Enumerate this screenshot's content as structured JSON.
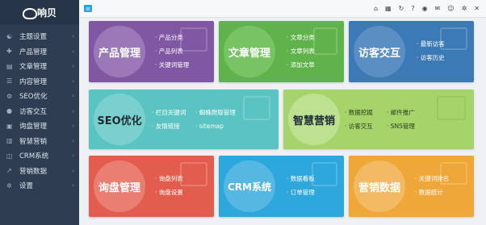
{
  "brand": {
    "name": "响贝"
  },
  "sidebar": {
    "items": [
      {
        "label": "主题设置",
        "icon": "people-icon"
      },
      {
        "label": "产品管理",
        "icon": "plus-icon"
      },
      {
        "label": "文章管理",
        "icon": "doc-icon"
      },
      {
        "label": "内容管理",
        "icon": "list-icon"
      },
      {
        "label": "SEO优化",
        "icon": "seo-icon"
      },
      {
        "label": "访客交互",
        "icon": "chat-icon"
      },
      {
        "label": "询盘管理",
        "icon": "box-icon"
      },
      {
        "label": "智慧营销",
        "icon": "chart-icon"
      },
      {
        "label": "CRM系统",
        "icon": "crm-icon"
      },
      {
        "label": "营销数据",
        "icon": "trend-icon"
      },
      {
        "label": "设置",
        "icon": "gear-icon"
      }
    ]
  },
  "topbar": {
    "icons": [
      "home-icon",
      "grid-icon",
      "refresh-icon",
      "help-icon",
      "location-icon",
      "message-icon",
      "user-icon",
      "settings-icon",
      "close-icon"
    ]
  },
  "tiles": {
    "product": {
      "title": "产品管理",
      "color": "#8057a3",
      "links": [
        "产品分类",
        "产品列表",
        "关键词管理"
      ]
    },
    "article": {
      "title": "文章管理",
      "color": "#5fb34a",
      "links": [
        "文章分类",
        "文章列表",
        "添加文章"
      ]
    },
    "visitor": {
      "title": "访客交互",
      "color": "#3b79b7",
      "links": [
        "最新访客",
        "访客历史"
      ]
    },
    "seo": {
      "title": "SEO优化",
      "color": "#59c4c1",
      "links": [
        "栏目关键词",
        "友情链接",
        "蜘蛛爬取管理",
        "sitemap"
      ]
    },
    "marketing": {
      "title": "智慧营销",
      "color": "#a6d36a",
      "links": [
        "数据挖掘",
        "访客交互",
        "邮件推广",
        "SNS管理"
      ]
    },
    "inquiry": {
      "title": "询盘管理",
      "color": "#e35d4f",
      "links": [
        "询盘列表",
        "询盘设置"
      ]
    },
    "crm": {
      "title": "CRM系统",
      "color": "#2ea7dc",
      "links": [
        "数据看板",
        "订单管理"
      ]
    },
    "data": {
      "title": "营销数据",
      "color": "#f0a73a",
      "links": [
        "关键词排名",
        "数据统计"
      ]
    }
  }
}
